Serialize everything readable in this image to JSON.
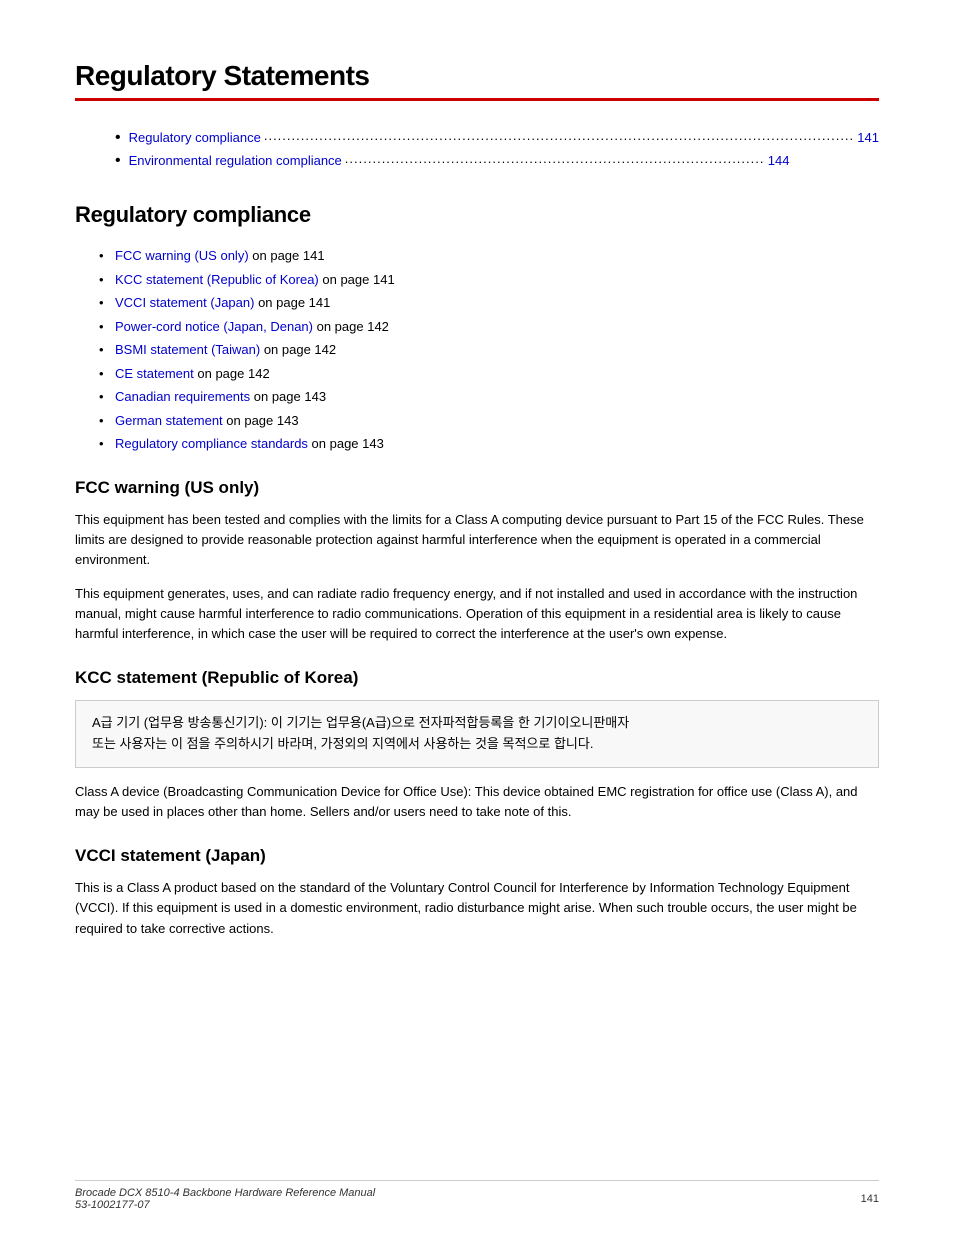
{
  "page": {
    "title": "Regulatory Statements",
    "red_rule": true
  },
  "toc": {
    "items": [
      {
        "label": "Regulatory compliance",
        "page": "141"
      },
      {
        "label": "Environmental regulation compliance",
        "page": "144"
      }
    ]
  },
  "regulatory_compliance": {
    "heading": "Regulatory compliance",
    "links": [
      {
        "text": "FCC warning (US only)",
        "suffix": " on page 141"
      },
      {
        "text": "KCC statement (Republic of Korea)",
        "suffix": " on page 141"
      },
      {
        "text": "VCCI statement (Japan)",
        "suffix": " on page 141"
      },
      {
        "text": "Power-cord notice (Japan, Denan)",
        "suffix": " on page 142"
      },
      {
        "text": "BSMI statement (Taiwan)",
        "suffix": " on page 142"
      },
      {
        "text": "CE statement",
        "suffix": " on page 142"
      },
      {
        "text": "Canadian requirements",
        "suffix": " on page 143"
      },
      {
        "text": "German statement",
        "suffix": " on page 143"
      },
      {
        "text": "Regulatory compliance standards",
        "suffix": " on page 143"
      }
    ]
  },
  "fcc_warning": {
    "heading": "FCC warning (US only)",
    "paragraphs": [
      "This equipment has been tested and complies with the limits for a Class A computing device pursuant to Part 15 of the FCC Rules. These limits are designed to provide reasonable protection against harmful interference when the equipment is operated in a commercial environment.",
      "This equipment generates, uses, and can radiate radio frequency energy, and if not installed and used in accordance with the instruction manual, might cause harmful interference to radio communications. Operation of this equipment in a residential area is likely to cause harmful interference, in which case the user will be required to correct the interference at the user's own expense."
    ]
  },
  "kcc_statement": {
    "heading": "KCC statement (Republic of Korea)",
    "box_text": "A급 기기 (업무용 방송통신기기): 이 기기는 업무용(A급)으로 전자파적합등록을 한 기기이오니판매자\n또는 사용자는 이 점을 주의하시기 바라며, 가정외의 지역에서 사용하는 것을 목적으로 합니다.",
    "paragraph": "Class A device (Broadcasting Communication Device for Office Use): This device obtained EMC registration for office use (Class A), and may be used in places other than home.  Sellers and/or users need to take note of this."
  },
  "vcci_statement": {
    "heading": "VCCI statement (Japan)",
    "paragraph": "This is a Class A product based on the standard of the Voluntary Control Council for Interference by Information Technology Equipment (VCCI). If this equipment is used in a domestic environment, radio disturbance might arise. When such trouble occurs, the user might be required to take corrective actions."
  },
  "footer": {
    "left_line1": "Brocade DCX 8510-4 Backbone Hardware Reference Manual",
    "left_line2": "53-1002177-07",
    "page_number": "141"
  }
}
